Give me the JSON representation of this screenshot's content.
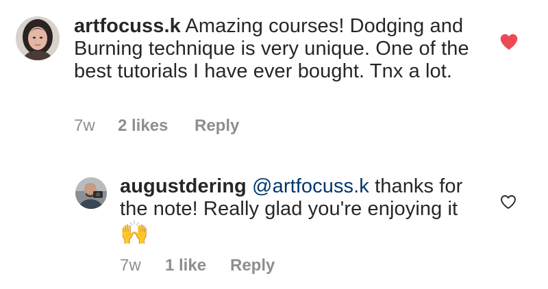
{
  "comments": [
    {
      "username": "artfocuss.k",
      "text": "Amazing courses! Dodging and Burning technique is very unique. One of the best tutorials I have ever bought. Tnx a lot.",
      "time": "7w",
      "likes": "2 likes",
      "reply_label": "Reply",
      "liked": true,
      "heart_color": "#ed4956",
      "avatar_icon": "user-avatar"
    },
    {
      "username": "augustdering",
      "mention": "@artfocuss.k",
      "text": "thanks for the note! Really glad you're enjoying it",
      "emoji": "🙌",
      "time": "7w",
      "likes": "1 like",
      "reply_label": "Reply",
      "liked": false,
      "heart_color": "#262626",
      "avatar_icon": "user-avatar"
    }
  ],
  "colors": {
    "text": "#262626",
    "meta": "#8e8e8e",
    "mention": "#00376b"
  }
}
